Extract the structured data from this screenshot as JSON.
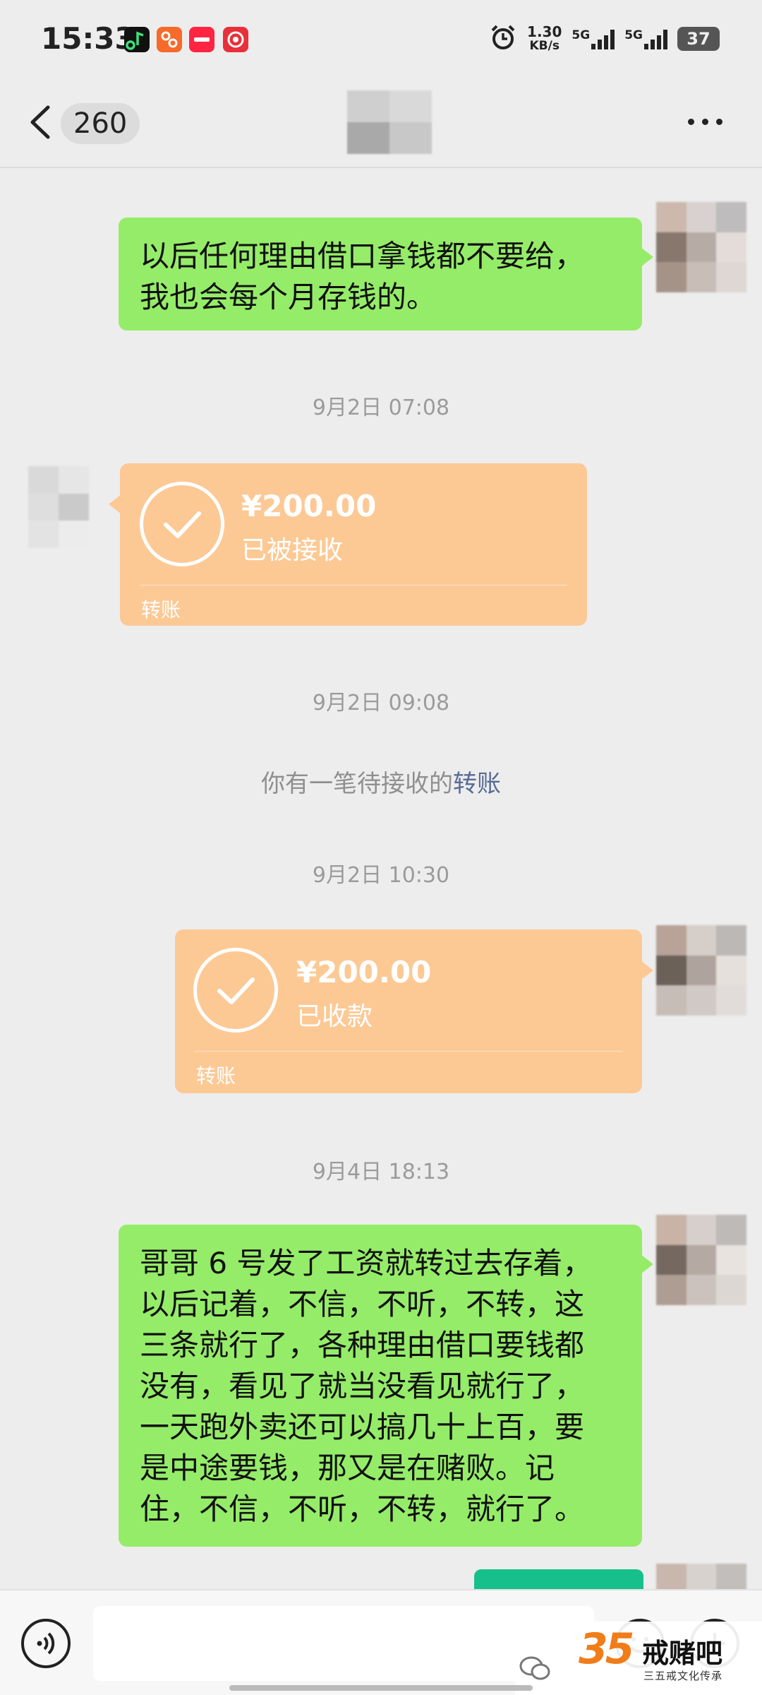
{
  "status_bar": {
    "time": "15:33",
    "net_speed_value": "1.30",
    "net_speed_unit": "KB/s",
    "sim1": "5G",
    "sim2": "5G",
    "battery": "37"
  },
  "nav": {
    "unread_count": "260"
  },
  "messages": [
    {
      "type": "text",
      "side": "right",
      "text_lines": [
        "以后任何理由借口拿钱都不要给，",
        "我也会每个月存钱的。"
      ]
    },
    {
      "type": "timestamp",
      "text": "9月2日 07:08"
    },
    {
      "type": "transfer",
      "side": "left",
      "amount": "¥200.00",
      "status": "已被接收",
      "label": "转账"
    },
    {
      "type": "timestamp",
      "text": "9月2日 09:08"
    },
    {
      "type": "system",
      "text": "你有一笔待接收的",
      "link": "转账"
    },
    {
      "type": "timestamp",
      "text": "9月2日 10:30"
    },
    {
      "type": "transfer",
      "side": "right",
      "amount": "¥200.00",
      "status": "已收款",
      "label": "转账"
    },
    {
      "type": "timestamp",
      "text": "9月4日 18:13"
    },
    {
      "type": "text",
      "side": "right",
      "text_lines": [
        "哥哥 6 号发了工资就转过去存着，",
        "以后记着，不信，不听，不转，这",
        "三条就行了，各种理由借口要钱都",
        "没有，看见了就当没看见就行了，",
        "一天跑外卖还可以搞几十上百，要",
        "是中途要钱，那又是在赌败。记",
        "住，不信，不听，不转，就行了。"
      ]
    }
  ],
  "watermark": {
    "number": "35",
    "name": "戒赌吧",
    "subtitle": "三五戒文化传承"
  },
  "colors": {
    "background": "#ededed",
    "bubble_green": "#95ec69",
    "transfer_orange": "#fcc995",
    "link_blue": "#576b95",
    "watermark_orange": "#f07d19"
  },
  "icons": [
    "back-chevron-icon",
    "more-dots-icon",
    "check-circle-icon",
    "voice-icon",
    "emoji-icon",
    "plus-icon",
    "wechat-icon"
  ]
}
